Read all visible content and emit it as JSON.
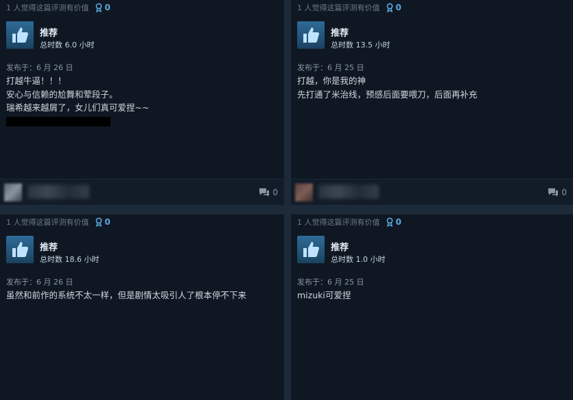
{
  "reviews": [
    {
      "helpful": "1 人觉得这篇评测有价值",
      "awards": "0",
      "recommendation": "推荐",
      "hours": "总时数 6.0 小时",
      "posted": "发布于：6 月 26 日",
      "body": [
        "打越牛逼！！！",
        "安心与信赖的尬舞和荤段子。",
        "瑞希越来越屑了，女儿们真可爱捏~~"
      ],
      "comments": "0"
    },
    {
      "helpful": "1 人觉得这篇评测有价值",
      "awards": "0",
      "recommendation": "推荐",
      "hours": "总时数 13.5 小时",
      "posted": "发布于：6 月 25 日",
      "body": [
        "打越，你是我的神",
        "先打通了米治线，预感后面要喂刀，后面再补充"
      ],
      "comments": "0"
    },
    {
      "helpful": "1 人觉得这篇评测有价值",
      "awards": "0",
      "recommendation": "推荐",
      "hours": "总时数 18.6 小时",
      "posted": "发布于：6 月 26 日",
      "body": [
        "虽然和前作的系统不太一样，但是剧情太吸引人了根本停不下来"
      ],
      "comments": ""
    },
    {
      "helpful": "1 人觉得这篇评测有价值",
      "awards": "0",
      "recommendation": "推荐",
      "hours": "总时数 1.0 小时",
      "posted": "发布于：6 月 25 日",
      "body": [
        "mizuki可爱捏"
      ],
      "comments": ""
    }
  ],
  "icons": {
    "award": "award-ribbon-icon",
    "recommend": "thumbs-up-icon",
    "comment": "comment-bubble-icon"
  },
  "colors": {
    "card_bg": "#0f1722",
    "accent": "#5aa9e0",
    "thumb_bg": "#2f6b98"
  }
}
